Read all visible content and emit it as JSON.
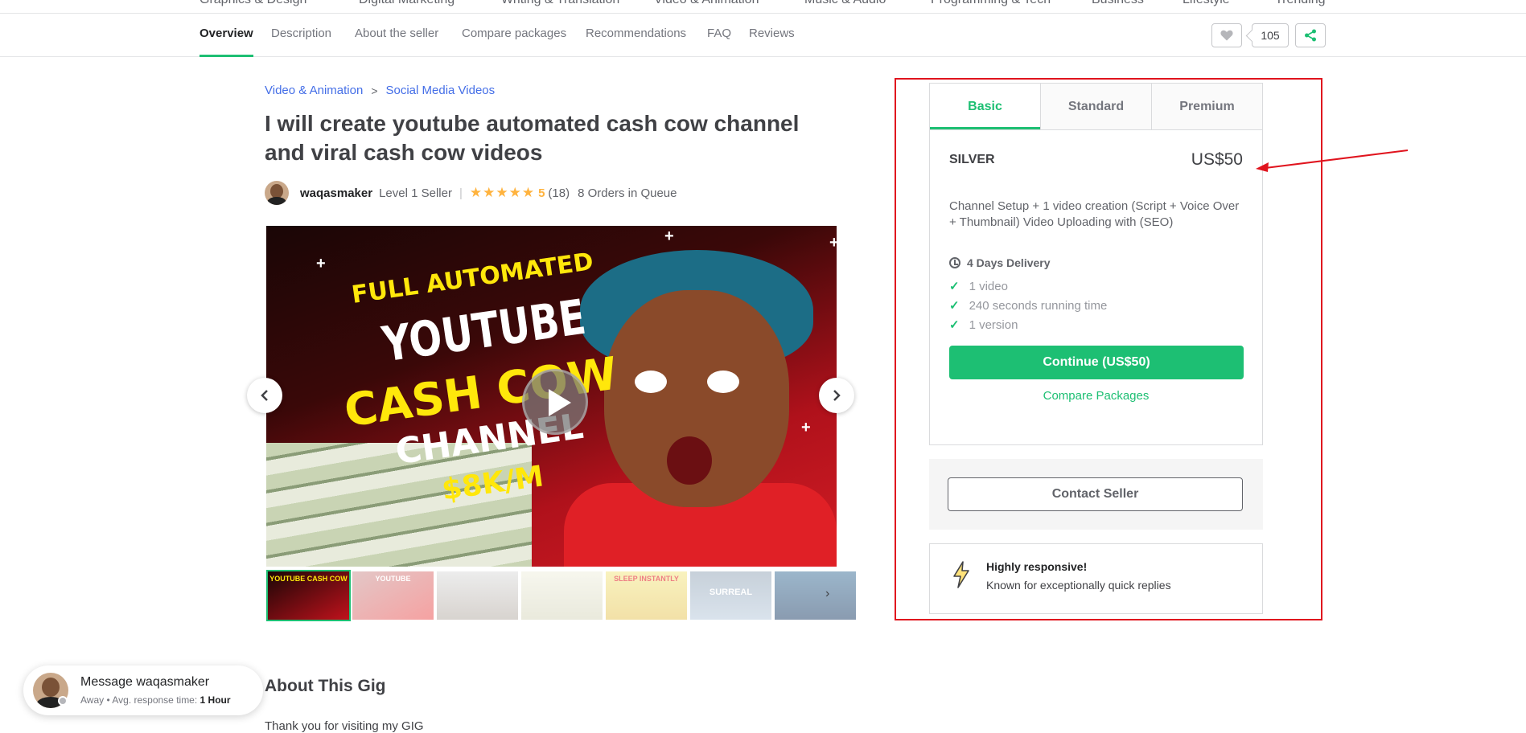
{
  "top_categories": [
    "Graphics & Design",
    "Digital Marketing",
    "Writing & Translation",
    "Video & Animation",
    "Music & Audio",
    "Programming & Tech",
    "Business",
    "Lifestyle",
    "Trending"
  ],
  "subnav": {
    "tabs": [
      "Overview",
      "Description",
      "About the seller",
      "Compare packages",
      "Recommendations",
      "FAQ",
      "Reviews"
    ],
    "active": "Overview",
    "like_count": "105"
  },
  "breadcrumb": {
    "category": "Video & Animation",
    "separator": ">",
    "subcategory": "Social Media Videos"
  },
  "gig": {
    "title": "I will create youtube automated cash cow channel and viral cash cow videos",
    "seller_name": "waqasmaker",
    "seller_level": "Level 1 Seller",
    "stars": "★★★★★",
    "rating_value": 5,
    "rating": "5",
    "reviews": "(18)",
    "queue": "8 Orders in Queue"
  },
  "gallery": {
    "lines": [
      "FULL AUTOMATED",
      "YOUTUBE",
      "CASH COW",
      "CHANNEL",
      "$8K/M"
    ],
    "thumb_labels": [
      "YOUTUBE CASH COW",
      "YOUTUBE",
      "",
      "",
      "SLEEP INSTANTLY",
      "SURREAL",
      ""
    ]
  },
  "package": {
    "tabs": [
      "Basic",
      "Standard",
      "Premium"
    ],
    "active_tab": "Basic",
    "name": "SILVER",
    "price": "US$50",
    "description": "Channel Setup + 1 video creation (Script + Voice Over + Thumbnail) Video Uploading with (SEO)",
    "delivery": "4 Days Delivery",
    "features": [
      "1 video",
      "240 seconds running time",
      "1 version"
    ],
    "continue_label": "Continue (US$50)",
    "compare_label": "Compare Packages"
  },
  "contact": {
    "label": "Contact Seller"
  },
  "responsive": {
    "title": "Highly responsive!",
    "subtitle": "Known for exceptionally quick replies"
  },
  "about": {
    "heading": "About This Gig",
    "intro": "Thank you for visiting my GIG"
  },
  "message": {
    "title": "Message waqasmaker",
    "status": "Away",
    "response_label": "Avg. response time:",
    "response_value": "1 Hour"
  },
  "colors": {
    "accent": "#1dbf73",
    "link": "#446ee7",
    "highlight_box": "#e0141e",
    "star": "#ffb33e"
  }
}
